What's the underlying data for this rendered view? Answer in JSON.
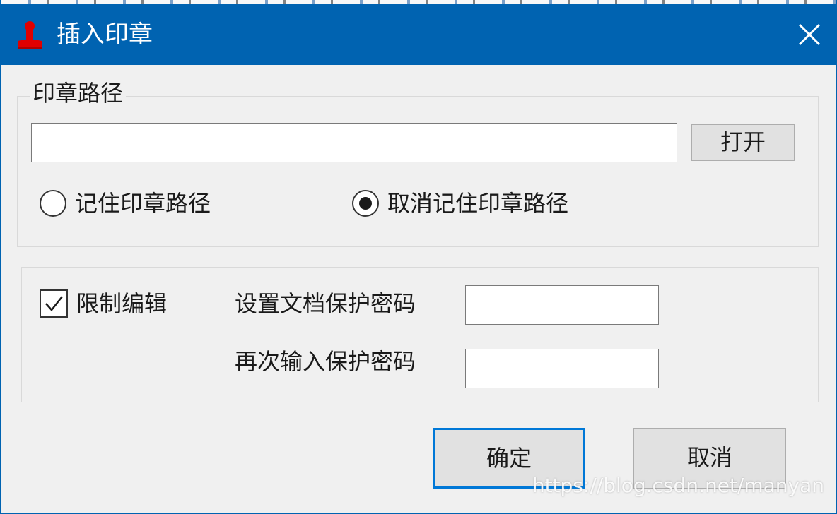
{
  "window": {
    "title": "插入印章",
    "icon": "seal-icon",
    "close_icon": "close-icon",
    "accent_color": "#0063b1"
  },
  "seal_path_group": {
    "legend": "印章路径",
    "path_value": "",
    "open_button": "打开",
    "radio_remember": "记住印章路径",
    "radio_forget": "取消记住印章路径",
    "selected": "取消记住印章路径"
  },
  "protect_group": {
    "restrict_label": "限制编辑",
    "restrict_checked": true,
    "set_password_label": "设置文档保护密码",
    "confirm_password_label": "再次输入保护密码",
    "set_password_value": "",
    "confirm_password_value": ""
  },
  "footer": {
    "ok_button": "确定",
    "cancel_button": "取消"
  },
  "watermark": "https://blog.csdn.net/manyan"
}
